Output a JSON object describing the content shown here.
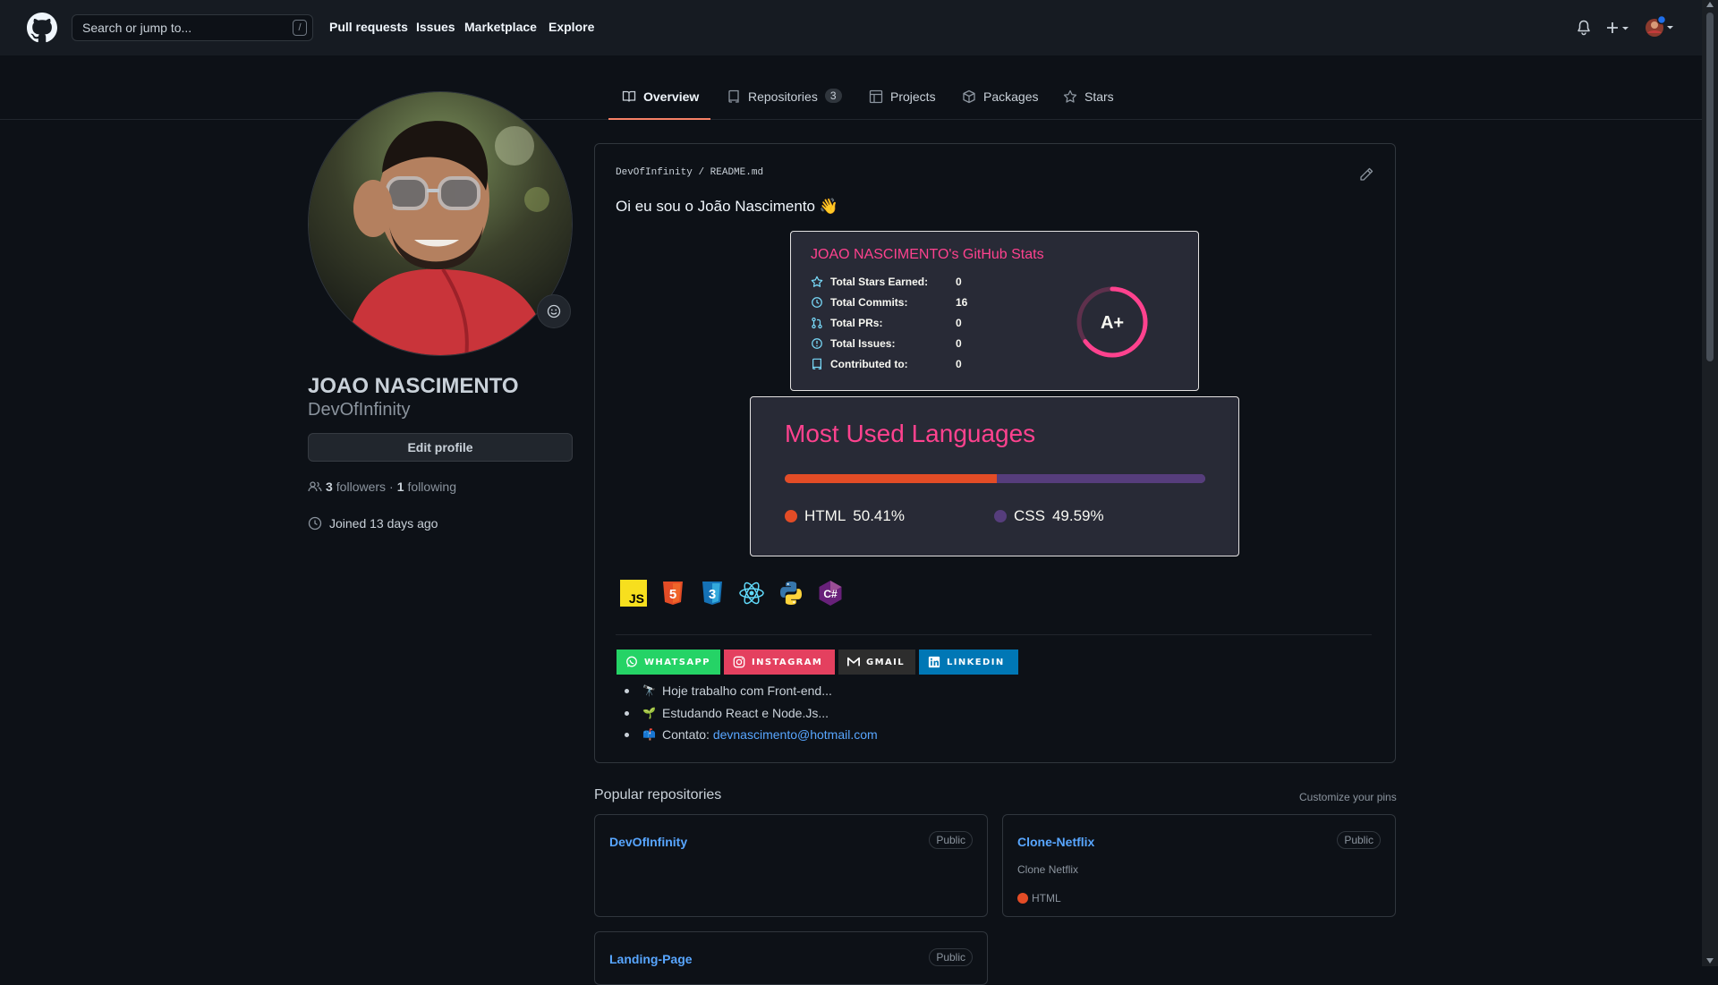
{
  "header": {
    "search_placeholder": "Search or jump to...",
    "search_shortcut": "/",
    "nav": [
      "Pull requests",
      "Issues",
      "Marketplace",
      "Explore"
    ]
  },
  "tabs": [
    {
      "label": "Overview",
      "icon": "book-icon",
      "active": true
    },
    {
      "label": "Repositories",
      "icon": "repo-icon",
      "count": "3"
    },
    {
      "label": "Projects",
      "icon": "table-icon"
    },
    {
      "label": "Packages",
      "icon": "package-icon"
    },
    {
      "label": "Stars",
      "icon": "star-icon"
    }
  ],
  "profile": {
    "full_name": "JOAO NASCIMENTO",
    "username": "DevOfInfinity",
    "edit_label": "Edit profile",
    "followers_count": "3",
    "followers_label": "followers",
    "separator": "·",
    "following_count": "1",
    "following_label": "following",
    "joined": "Joined 13 days ago"
  },
  "readme": {
    "owner": "DevOfInfinity",
    "sep": "/",
    "file": "README.md",
    "greeting": "Oi eu sou o João Nascimento 👋",
    "stats_card": {
      "title": "JOAO NASCIMENTO's GitHub Stats",
      "rows": [
        {
          "label": "Total Stars Earned:",
          "value": "0",
          "icon": "star-icon"
        },
        {
          "label": "Total Commits:",
          "value": "16",
          "icon": "history-icon"
        },
        {
          "label": "Total PRs:",
          "value": "0",
          "icon": "pull-request-icon"
        },
        {
          "label": "Total Issues:",
          "value": "0",
          "icon": "issue-icon"
        },
        {
          "label": "Contributed to:",
          "value": "0",
          "icon": "repo-icon"
        }
      ],
      "rank": "A+",
      "rank_progress": 0.65
    },
    "lang_card": {
      "title": "Most Used Languages",
      "languages": [
        {
          "name": "HTML",
          "percent": "50.41%",
          "value": 50.41,
          "color": "#e34c26"
        },
        {
          "name": "CSS",
          "percent": "49.59%",
          "value": 49.59,
          "color": "#563d7c"
        }
      ]
    },
    "tech_icons": [
      "javascript-icon",
      "html5-icon",
      "css3-icon",
      "react-icon",
      "python-icon",
      "csharp-icon"
    ],
    "tech_labels": {
      "js": "JS",
      "html": "5",
      "css": "3",
      "csharp": "C#"
    },
    "badges": [
      {
        "label": "WHATSAPP",
        "color": "#25d366",
        "icon": "whatsapp-icon"
      },
      {
        "label": "INSTAGRAM",
        "color": "#e4405f",
        "icon": "instagram-icon"
      },
      {
        "label": "GMAIL",
        "color": "#2d2d2d",
        "icon": "gmail-icon"
      },
      {
        "label": "LINKEDIN",
        "color": "#0077b5",
        "icon": "linkedin-icon"
      }
    ],
    "bullets": [
      {
        "emoji": "🔭",
        "text": "Hoje trabalho com Front-end..."
      },
      {
        "emoji": "🌱",
        "text": "Estudando React e Node.Js..."
      },
      {
        "emoji": "📫",
        "text": "Contato: ",
        "link": "devnascimento@hotmail.com"
      }
    ]
  },
  "popular": {
    "title": "Popular repositories",
    "customize": "Customize your pins",
    "repos": [
      {
        "name": "DevOfInfinity",
        "visibility": "Public",
        "description": "",
        "language": ""
      },
      {
        "name": "Clone-Netflix",
        "visibility": "Public",
        "description": "Clone Netflix",
        "language": "HTML",
        "language_color": "#e34c26"
      },
      {
        "name": "Landing-Page",
        "visibility": "Public",
        "description": "",
        "language": ""
      }
    ]
  },
  "colors": {
    "accent_tab": "#f78166",
    "link": "#58a6ff",
    "card_title": "#fe428e",
    "background": "#0d1117"
  }
}
